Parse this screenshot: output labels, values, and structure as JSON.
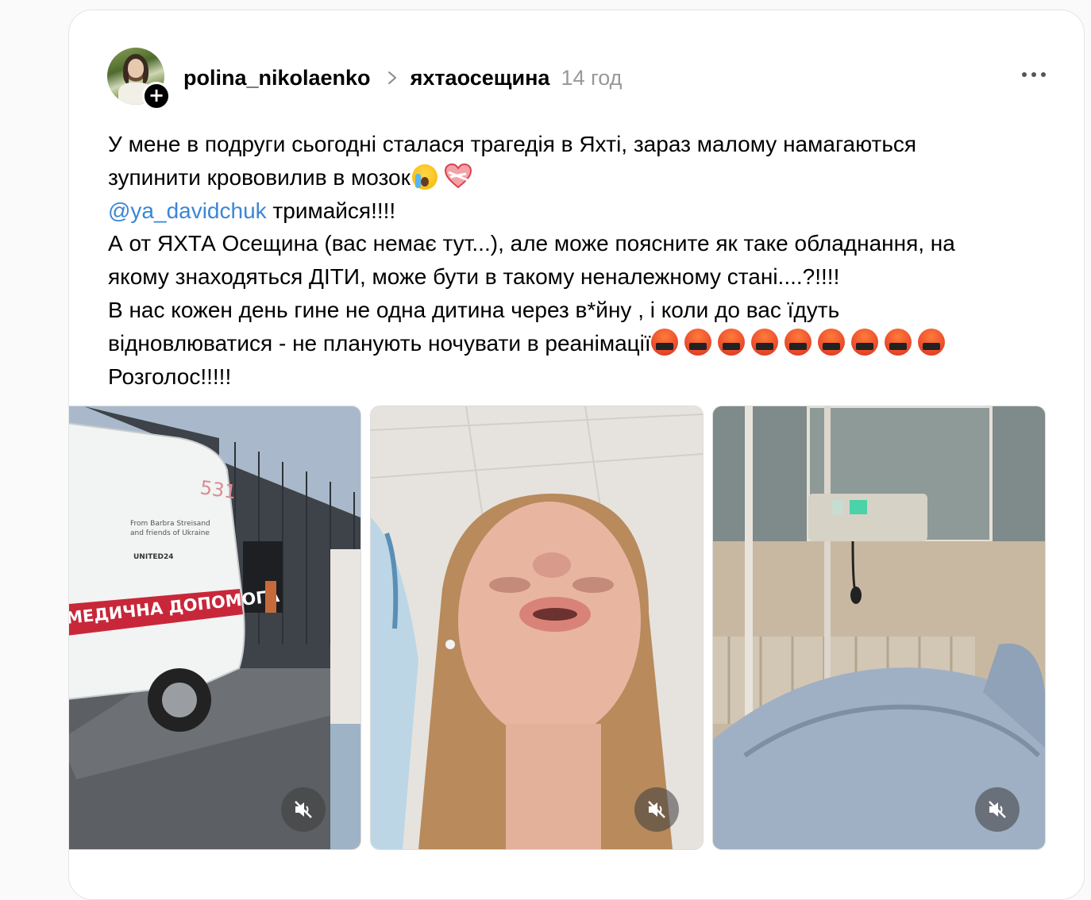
{
  "post": {
    "username": "polina_nikolaenko",
    "community": "яхтаосещина",
    "time": "14 год",
    "follow_symbol": "+",
    "text": {
      "line1": "У мене в подруги сьогодні сталася трагедія в Яхті, зараз малому намагаються",
      "line2": "зупинити крововилив в мозок",
      "mention": "@ya_davidchuk",
      "line3_rest": " тримайся!!!!",
      "line4": "А от ЯХТА Осещина (вас немає тут...), але може поясните як таке обладнання, на",
      "line5": "якому знаходяться ДІТИ, може бути в такому неналежному стані....?!!!!",
      "line6": "В нас кожен день гине не одна дитина через в*йну , і коли до вас їдуть",
      "line7": "відновлюватися - не планують ночувати в реанімації",
      "line8": "Розголос!!!!!"
    },
    "emojis": {
      "after_line2": [
        "loudly-crying-face",
        "mending-heart"
      ],
      "after_line7": [
        "face-with-symbols-on-mouth",
        "face-with-symbols-on-mouth",
        "face-with-symbols-on-mouth",
        "face-with-symbols-on-mouth",
        "face-with-symbols-on-mouth",
        "face-with-symbols-on-mouth",
        "face-with-symbols-on-mouth",
        "face-with-symbols-on-mouth",
        "face-with-symbols-on-mouth"
      ]
    },
    "media": [
      {
        "kind": "video",
        "description_icon": "ambulance-scene",
        "ambulance_label": "МЕДИЧНА ДОПОМОГА",
        "ambulance_number": "531",
        "side_text_1": "From Barbra Streisand",
        "side_text_2": "and friends of Ukraine",
        "side_text_3": "UNITED24",
        "muted": true
      },
      {
        "kind": "video",
        "description_icon": "selfie-scene",
        "muted": true
      },
      {
        "kind": "video",
        "description_icon": "hospital-bed-scene",
        "muted": true
      }
    ]
  },
  "colors": {
    "mention": "#3b86d6",
    "time": "#999999",
    "card_bg": "#ffffff",
    "page_bg": "#fafafa"
  }
}
